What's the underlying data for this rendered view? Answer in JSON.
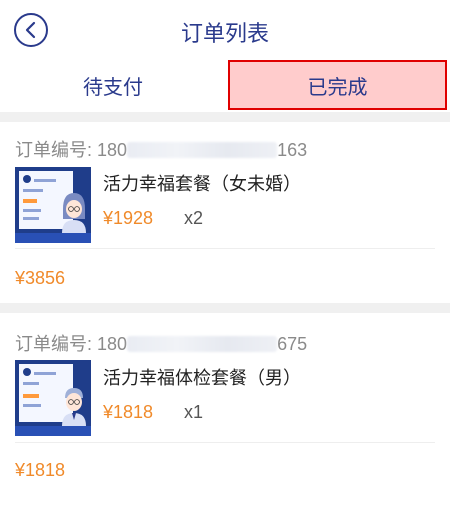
{
  "header": {
    "title": "订单列表",
    "back_icon": "chevron-left-icon"
  },
  "tabs": [
    {
      "label": "待支付",
      "selected": false
    },
    {
      "label": "已完成",
      "selected": true
    }
  ],
  "orders": [
    {
      "order_no_label": "订单编号:",
      "order_no_prefix": "180",
      "order_no_suffix": "163",
      "product_name": "活力幸福套餐（女未婚）",
      "price": "¥1928",
      "qty": "x2",
      "total": "¥3856"
    },
    {
      "order_no_label": "订单编号:",
      "order_no_prefix": "180",
      "order_no_suffix": "675",
      "product_name": "活力幸福体检套餐（男）",
      "price": "¥1818",
      "qty": "x1",
      "total": "¥1818"
    }
  ],
  "colors": {
    "primary": "#2a3a8c",
    "price": "#f08a2a",
    "tab_highlight": "#ffcccc",
    "tab_border": "#e00000"
  }
}
